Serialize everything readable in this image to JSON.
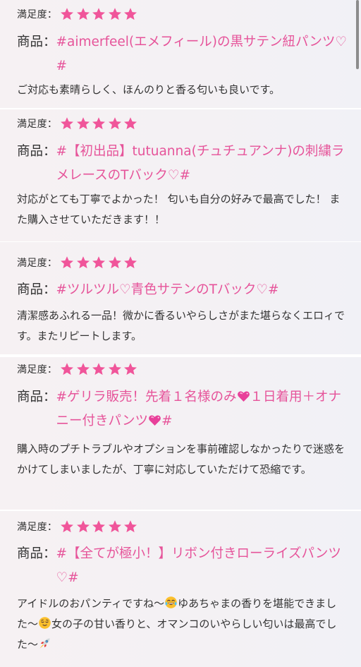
{
  "rating_label": "満足度：",
  "product_prefix": "商品：",
  "star_color": "#f0559a",
  "link_color": "#e6549a",
  "reviews": [
    {
      "stars": 5,
      "product": "#aimerfeel(エメフィール)の黒サテン紐パンツ♡#",
      "comment": "ご対応も素晴らしく、ほんのりと香る匂いも良いです。"
    },
    {
      "stars": 5,
      "product": "#【初出品】tutuanna(チュチュアンナ)の刺繍ラメレースのTバック♡#",
      "comment": "対応がとても丁寧でよかった！ 匂いも自分の好みで最高でした！ また購入させていただきます！！"
    },
    {
      "stars": 5,
      "product": "#ツルツル♡青色サテンのTバック♡#",
      "comment": "清潔感あふれる一品！微かに香るいやらしさがまた堪らなくエロィです。またリピートします。"
    },
    {
      "stars": 5,
      "product_parts": [
        "#ゲリラ販売！先着１名様のみ",
        "１日着用＋オナニー付きパンツ",
        "#"
      ],
      "product_icons": [
        "pink-heart-icon",
        "pink-heart-icon"
      ],
      "comment": "購入時のプチトラブルやオプションを事前確認しなかったりで迷惑をかけてしまいましたが、丁寧に対応していただけて恐縮です。"
    },
    {
      "stars": 5,
      "product": "#【全てが極小！】リボン付きローライズパンツ♡#",
      "comment_parts": [
        "アイドルのおパンティですね〜",
        "ゆあちゃまの香りを堪能できました〜",
        "女の子の甘い香りと、オマンコのいやらしい匂いは最高でした〜"
      ],
      "comment_icons": [
        "tears-of-joy-emoji",
        "relieved-face-emoji",
        "rocket-emoji"
      ]
    }
  ]
}
